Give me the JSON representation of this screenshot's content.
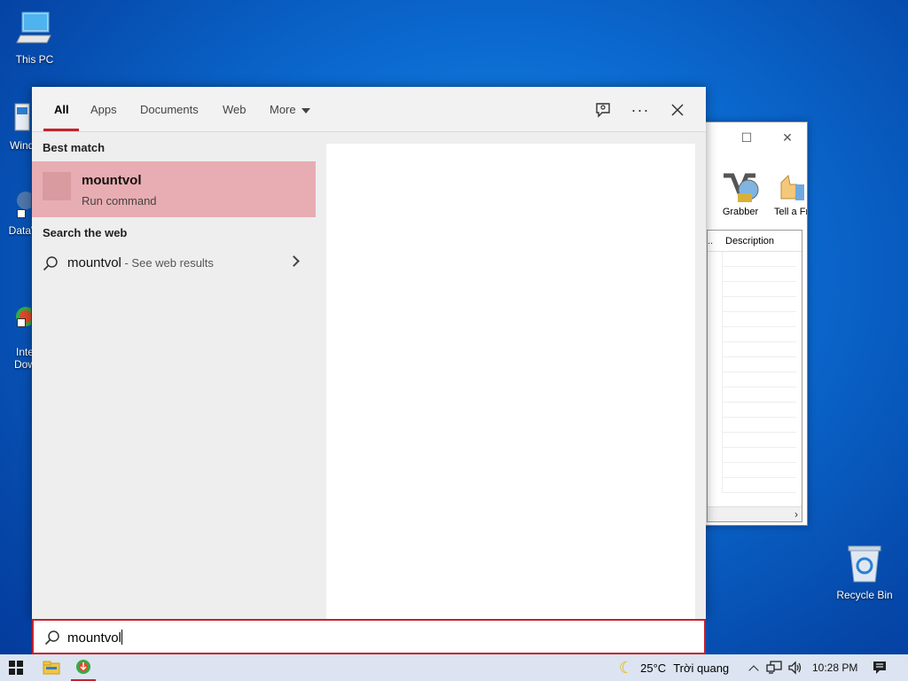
{
  "desktop": {
    "icons": [
      {
        "label": "This PC"
      },
      {
        "label": "Windo"
      },
      {
        "label": "DataW"
      },
      {
        "label": "Inte\nDow"
      },
      {
        "label": "Recycle Bin"
      }
    ]
  },
  "background_window": {
    "toolbar": [
      {
        "label": "Grabber"
      },
      {
        "label": "Tell a Fri"
      }
    ],
    "column_header": "Description"
  },
  "search": {
    "tabs": [
      {
        "label": "All",
        "active": true
      },
      {
        "label": "Apps"
      },
      {
        "label": "Documents"
      },
      {
        "label": "Web"
      },
      {
        "label": "More"
      }
    ],
    "best_match_title": "Best match",
    "best_match": {
      "name": "mountvol",
      "type": "Run command"
    },
    "web_title": "Search the web",
    "web_result": {
      "query": "mountvol",
      "hint": " - See web results"
    },
    "query": "mountvol",
    "accent_color": "#c4222e"
  },
  "taskbar": {
    "weather": {
      "temp": "25°C",
      "condition": "Trời quang"
    },
    "time": "10:28 PM",
    "background": "#dbe4f0"
  }
}
